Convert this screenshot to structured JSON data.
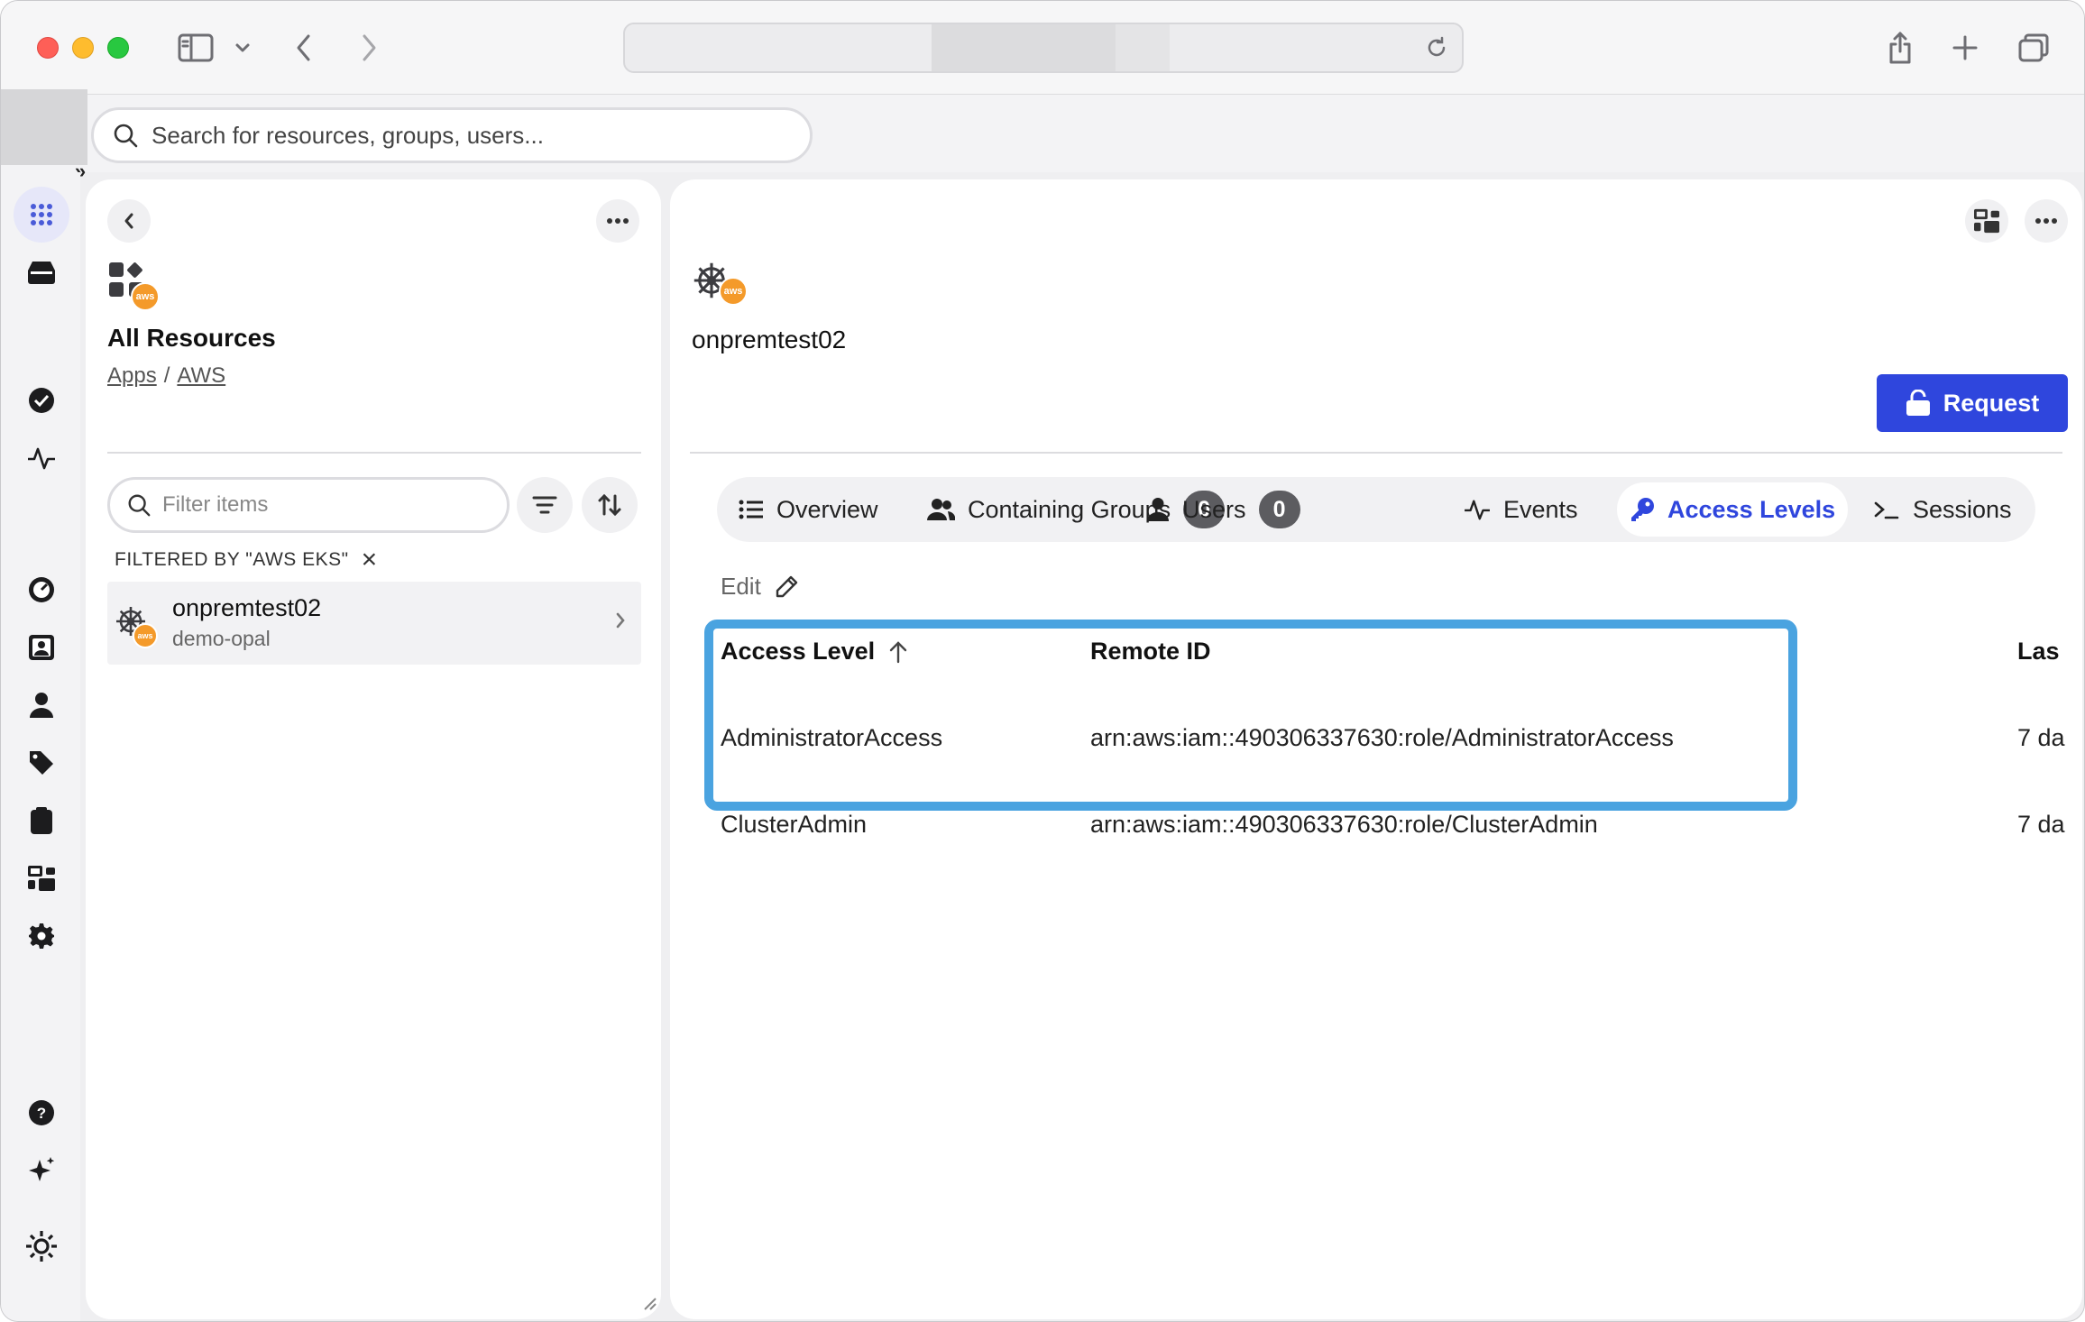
{
  "browser": {
    "address_text": ""
  },
  "search": {
    "placeholder": "Search for resources, groups, users..."
  },
  "rail": {
    "items": [
      "apps-grid-icon",
      "inbox-icon",
      "check-circle-icon",
      "activity-icon",
      "dashboard-gauge-icon",
      "contact-card-icon",
      "user-icon",
      "tag-icon",
      "clipboard-icon",
      "groups-icon",
      "settings-gear-icon",
      "help-icon",
      "sparkle-icon",
      "sun-gear-icon"
    ]
  },
  "left_panel": {
    "title": "All Resources",
    "breadcrumb": {
      "apps": "Apps",
      "separator": "/",
      "aws": "AWS"
    },
    "filter_placeholder": "Filter items",
    "filtered_by": "FILTERED BY \"AWS EKS\"",
    "items": [
      {
        "name": "onpremtest02",
        "subtitle": "demo-opal"
      }
    ]
  },
  "right_panel": {
    "title": "onpremtest02",
    "request_label": "Request",
    "tabs": [
      {
        "label": "Overview"
      },
      {
        "label": "Containing Groups",
        "count": "0"
      },
      {
        "label": "Users",
        "count": "0"
      },
      {
        "label": "Events"
      },
      {
        "label": "Access Levels"
      },
      {
        "label": "Sessions"
      }
    ],
    "edit_label": "Edit",
    "table": {
      "headers": [
        "Access Level",
        "Remote ID",
        "Las"
      ],
      "rows": [
        {
          "access_level": "AdministratorAccess",
          "remote_id": "arn:aws:iam::490306337630:role/AdministratorAccess",
          "last": "7 da"
        },
        {
          "access_level": "ClusterAdmin",
          "remote_id": "arn:aws:iam::490306337630:role/ClusterAdmin",
          "last": "7 da"
        }
      ]
    }
  },
  "badge_text": "aws",
  "colors": {
    "accent": "#2f46dd",
    "highlight": "#4aa3e0",
    "aws_orange": "#f49a2a"
  }
}
